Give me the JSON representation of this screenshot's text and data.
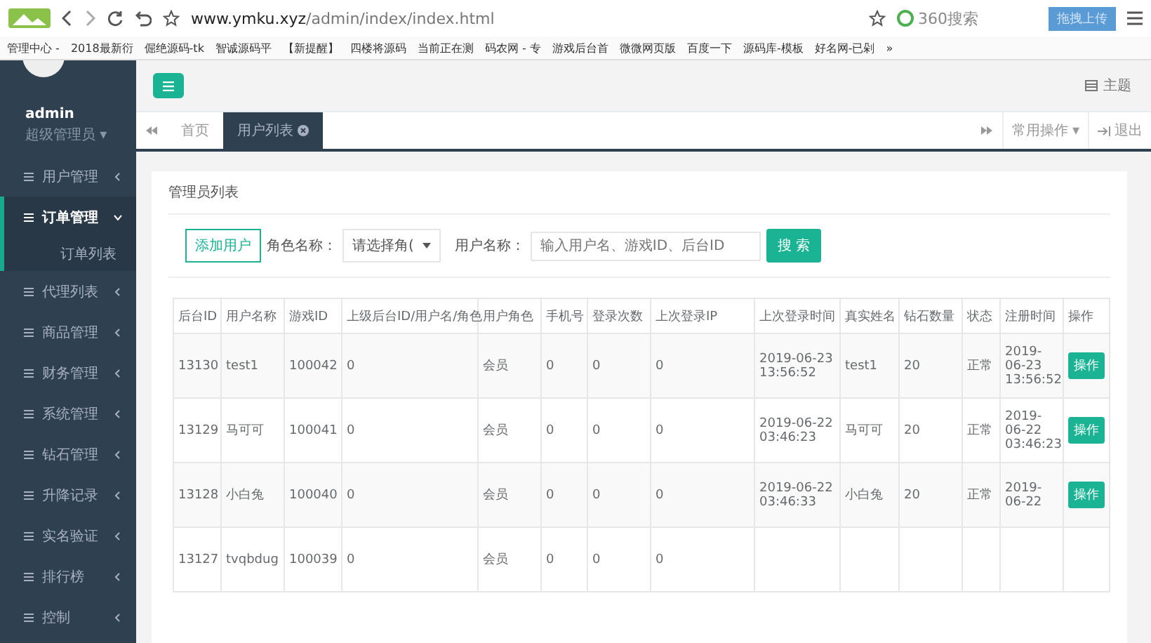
{
  "browser": {
    "url_host": "www.ymku.xyz",
    "url_path": "/admin/index/index.html",
    "search_placeholder": "360搜索",
    "upload_label": "拖拽上传",
    "bookmarks": [
      "管理中心 -",
      "2018最新衍",
      "倔绝源码-tk",
      "智诚源码平",
      "【新提醒】",
      "四楼将源码",
      "当前正在测",
      "码农网 - 专",
      "游戏后台首",
      "微微网页版",
      "百度一下",
      "源码库-模板",
      "好名网-已剁",
      "»"
    ]
  },
  "sidebar": {
    "user_name": "admin",
    "user_role": "超级管理员 ▾",
    "items": [
      {
        "label": "用户管理",
        "selected": false,
        "expanded": false
      },
      {
        "label": "订单管理",
        "selected": true,
        "expanded": true,
        "children": [
          {
            "label": "订单列表"
          }
        ]
      },
      {
        "label": "代理列表",
        "selected": false,
        "expanded": false
      },
      {
        "label": "商品管理",
        "selected": false,
        "expanded": false
      },
      {
        "label": "财务管理",
        "selected": false,
        "expanded": false
      },
      {
        "label": "系统管理",
        "selected": false,
        "expanded": false
      },
      {
        "label": "钻石管理",
        "selected": false,
        "expanded": false
      },
      {
        "label": "升降记录",
        "selected": false,
        "expanded": false
      },
      {
        "label": "实名验证",
        "selected": false,
        "expanded": false
      },
      {
        "label": "排行榜",
        "selected": false,
        "expanded": false
      },
      {
        "label": "控制",
        "selected": false,
        "expanded": false
      }
    ]
  },
  "header": {
    "theme_label": "主题"
  },
  "tabs": [
    {
      "label": "首页",
      "selected": false,
      "closable": false
    },
    {
      "label": "用户列表",
      "selected": true,
      "closable": true
    }
  ],
  "tab_tools": {
    "ops_label": "常用操作 ▾",
    "logout_label": "退出"
  },
  "panel": {
    "title": "管理员列表",
    "add_button": "添加用户",
    "role_label": "角色名称：",
    "role_select": "请选择角(",
    "user_label": "用户名称：",
    "user_placeholder": "输入用户名、游戏ID、后台ID",
    "search_button": "搜 索"
  },
  "table": {
    "columns": [
      "后台ID",
      "用户名称",
      "游戏ID",
      "上级后台ID/用户名/角色",
      "用户角色",
      "手机号",
      "登录次数",
      "上次登录IP",
      "上次登录时间",
      "真实姓名",
      "钻石数量",
      "状态",
      "注册时间",
      "操作"
    ],
    "rows": [
      {
        "cells": [
          "13130",
          "test1",
          "100042",
          "0",
          "会员",
          "0",
          "0",
          "0",
          "2019-06-23 13:56:52",
          "test1",
          "20",
          "正常",
          "2019-06-23 13:56:52"
        ],
        "action": "操作"
      },
      {
        "cells": [
          "13129",
          "马可可",
          "100041",
          "0",
          "会员",
          "0",
          "0",
          "0",
          "2019-06-22 03:46:23",
          "马可可",
          "20",
          "正常",
          "2019-06-22 03:46:23"
        ],
        "action": "操作"
      },
      {
        "cells": [
          "13128",
          "小白兔",
          "100040",
          "0",
          "会员",
          "0",
          "0",
          "0",
          "2019-06-22 03:46:33",
          "小白兔",
          "20",
          "正常",
          "2019-06-22"
        ],
        "action": "操作"
      },
      {
        "cells": [
          "13127",
          "tvqbdug",
          "100039",
          "0",
          "会员",
          "0",
          "0",
          "0"
        ]
      }
    ]
  }
}
